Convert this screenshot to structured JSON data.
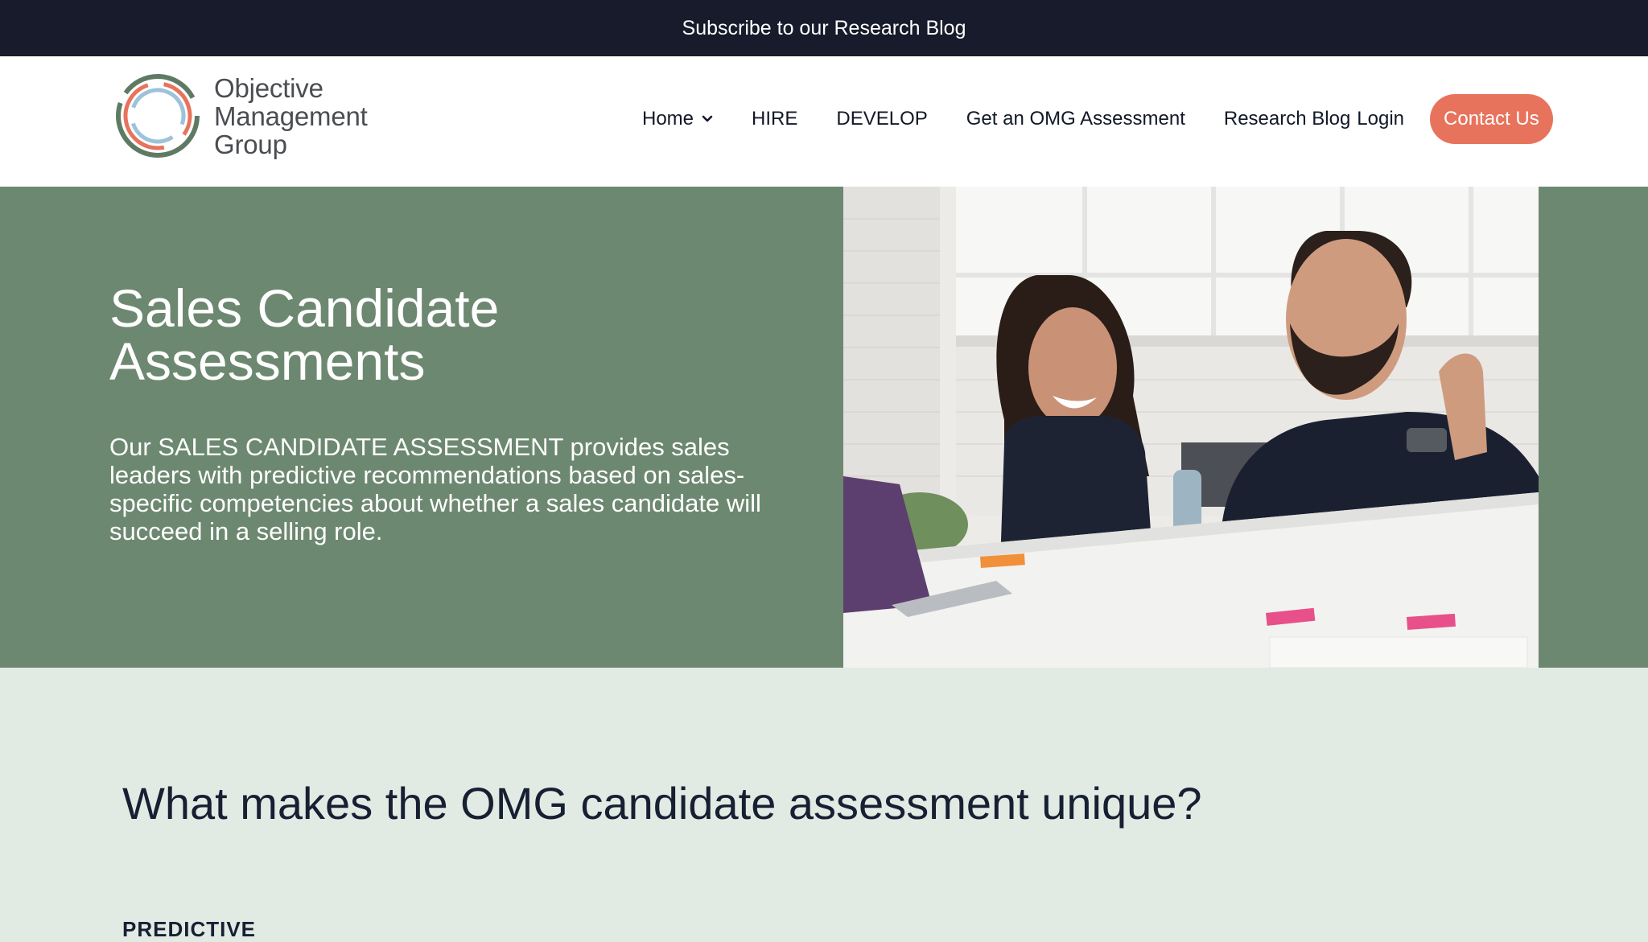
{
  "topbar": {
    "text": "Subscribe to our Research Blog"
  },
  "logo": {
    "lines": [
      "Objective",
      "Management",
      "Group"
    ]
  },
  "nav": {
    "home": "Home",
    "hire": "HIRE",
    "develop": "DEVELOP",
    "assessment": "Get an OMG Assessment",
    "blog": "Research Blog",
    "login": "Login",
    "contact": "Contact Us"
  },
  "hero": {
    "title_line1": "Sales Candidate",
    "title_line2": "Assessments",
    "description": "Our SALES CANDIDATE ASSESSMENT provides sales leaders with predictive recommendations based on sales-specific competencies about whether a sales candidate will succeed in a selling role."
  },
  "section": {
    "title": "What makes the OMG candidate assessment unique?",
    "subtitle": "PREDICTIVE"
  },
  "colors": {
    "topbar_bg": "#181b2b",
    "hero_bg": "#6d8870",
    "section_bg": "#e2ebe3",
    "accent": "#e8735c",
    "logo_green": "#5f7a63",
    "logo_blue": "#9cc3d9"
  }
}
